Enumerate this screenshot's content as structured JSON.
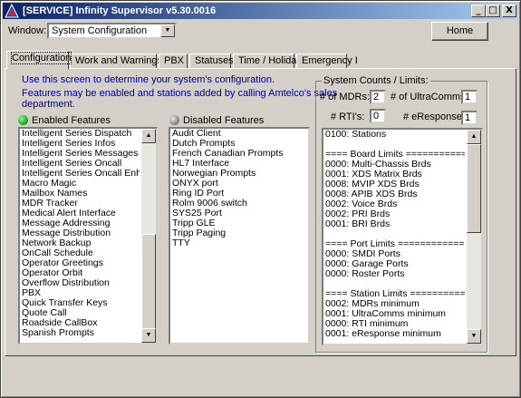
{
  "window": {
    "title": "[SERVICE]   Infinity Supervisor  v5.30.0016",
    "minimize_label": "_",
    "maximize_label": "□",
    "close_label": "X"
  },
  "toolbar": {
    "window_label": "Window:",
    "window_value": "System Configuration",
    "home_label": "Home"
  },
  "tabs": [
    {
      "label": "Configuration"
    },
    {
      "label": "Work and Warnings"
    },
    {
      "label": "PBX"
    },
    {
      "label": "Statuses"
    },
    {
      "label": "Time / Holiday"
    },
    {
      "label": "Emergency I"
    }
  ],
  "info": {
    "line1": "Use this screen to determine your system's configuration.",
    "line2": "Features may be enabled and stations added by calling Amtelco's sales",
    "line3": "department."
  },
  "enabled": {
    "label": "Enabled Features",
    "items": [
      "Intelligent Series Dispatch",
      "Intelligent Series Infos",
      "Intelligent Series Messages",
      "Intelligent Series Oncall",
      "Intelligent Series Oncall Enhance",
      "Macro Magic",
      "Mailbox Names",
      "MDR Tracker",
      "Medical Alert Interface",
      "Message Addressing",
      "Message Distribution",
      "Network Backup",
      "OnCall Schedule",
      "Operator Greetings",
      "Operator Orbit",
      "Overflow Distribution",
      "PBX",
      "Quick Transfer Keys",
      "Quote Call",
      "Roadside CallBox",
      "Spanish Prompts"
    ]
  },
  "disabled": {
    "label": "Disabled Features",
    "items": [
      "Audit Client",
      "Dutch Prompts",
      "French Canadian Prompts",
      "HL7 Interface",
      "Norwegian Prompts",
      "ONYX port",
      "Ring ID Port",
      "Rolm 9006 switch",
      "SYS25 Port",
      "Tripp GLE",
      "Tripp Paging",
      "TTY"
    ]
  },
  "limits": {
    "title": "System Counts / Limits:",
    "mdrs_label": "# of MDRs:",
    "mdrs_value": "2",
    "ultracomms_label": "# of UltraComms:",
    "ultracomms_value": "1",
    "rtis_label": "# RTI's:",
    "rtis_value": "0",
    "eresponse_label": "# eResponse:",
    "eresponse_value": "1",
    "list": [
      "0100: Stations",
      "",
      "==== Board Limits =============",
      "0000: Multi-Chassis Brds",
      "0001: XDS Matrix Brds",
      "0008: MVIP XDS Brds",
      "0008: APIB XDS Brds",
      "0002: Voice Brds",
      "0002: PRI Brds",
      "0001: BRI Brds",
      "",
      "==== Port Limits ===============",
      "0000: SMDI Ports",
      "0000: Garage Ports",
      "0000: Roster Ports",
      "",
      "==== Station Limits =============",
      "0002: MDRs minimum",
      "0001: UltraComms minimum",
      "0000: RTI minimum",
      "0001: eResponse minimum"
    ]
  },
  "colors": {
    "enabled_dot": "#1fb01f",
    "disabled_dot": "#8a8a8a",
    "info_text": "#0000a0"
  },
  "icons": {
    "app": "a-icon",
    "scroll_up": "triangle-up",
    "scroll_down": "triangle-down",
    "dropdown": "triangle-down"
  }
}
